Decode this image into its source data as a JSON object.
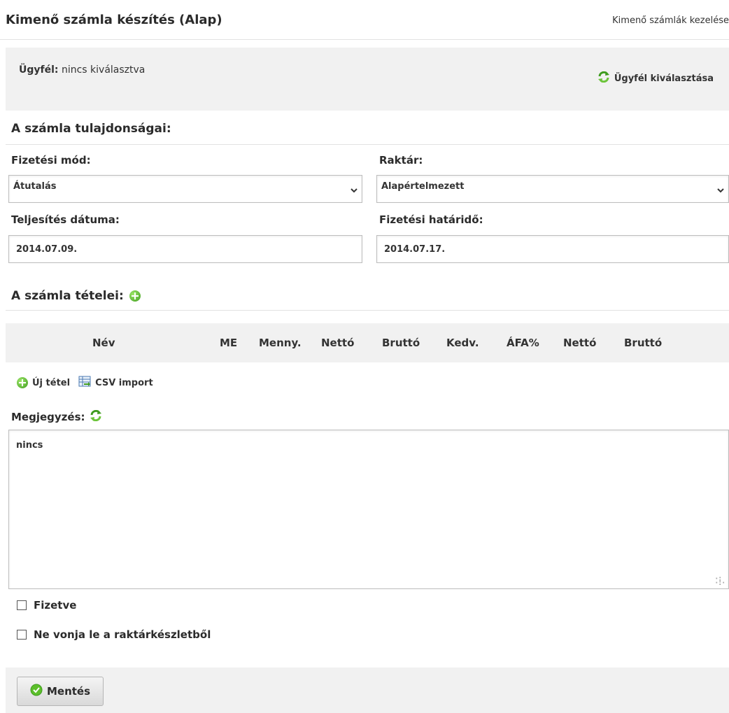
{
  "header": {
    "title": "Kimenő számla készítés (Alap)",
    "manage_link": "Kimenő számlák kezelése"
  },
  "client": {
    "label": "Ügyfél:",
    "value": "nincs kiválasztva",
    "select_button": "Ügyfél kiválasztása"
  },
  "properties": {
    "title": "A számla tulajdonságai:",
    "payment_method_label": "Fizetési mód:",
    "payment_method_value": "Átutalás",
    "warehouse_label": "Raktár:",
    "warehouse_value": "Alapértelmezett",
    "fulfillment_date_label": "Teljesítés dátuma:",
    "fulfillment_date_value": "2014.07.09.",
    "due_date_label": "Fizetési határidő:",
    "due_date_value": "2014.07.17."
  },
  "items": {
    "title": "A számla tételei:",
    "columns": [
      "Név",
      "ME",
      "Menny.",
      "Nettó",
      "Bruttó",
      "Kedv.",
      "ÁFA%",
      "Nettó",
      "Bruttó"
    ],
    "new_item": "Új tétel",
    "csv_import": "CSV import"
  },
  "note": {
    "label": "Megjegyzés:",
    "value": "nincs"
  },
  "checkboxes": {
    "paid": "Fizetve",
    "no_stock_deduct": "Ne vonja le a raktárkészletből"
  },
  "footer": {
    "save": "Mentés"
  },
  "colors": {
    "accent_green": "#3f9b1f",
    "panel_bg": "#f1f1f1",
    "border": "#bdbdbd"
  }
}
